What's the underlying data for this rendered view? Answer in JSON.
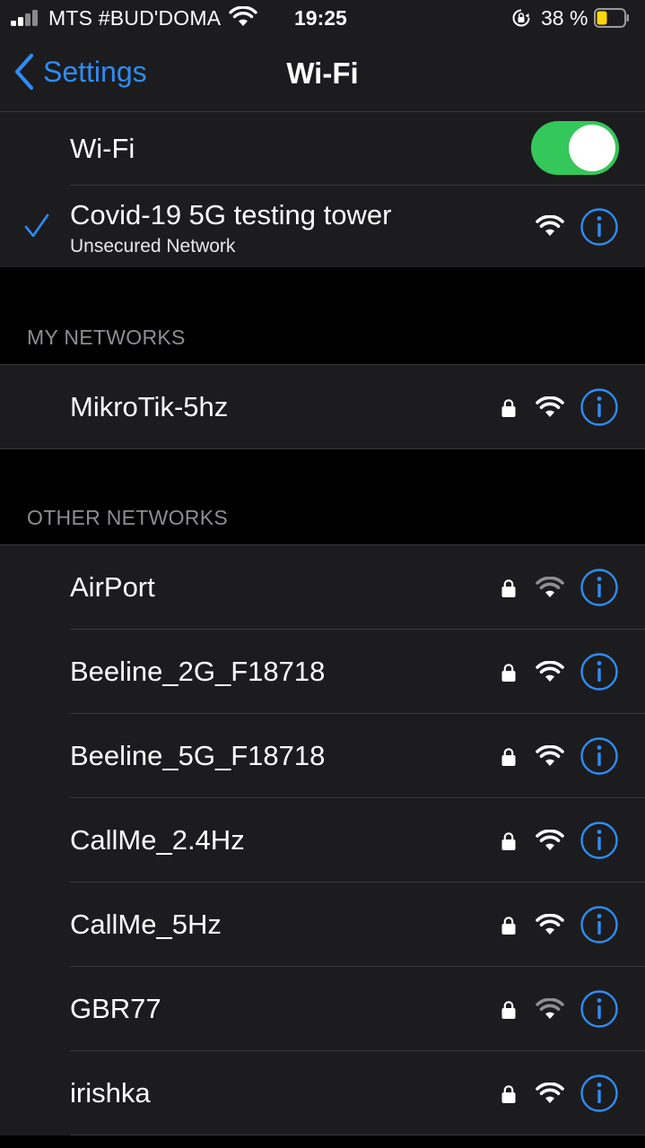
{
  "status_bar": {
    "carrier": "MTS #BUD'DOMA",
    "time": "19:25",
    "battery_percent": "38 %",
    "battery_level": 0.38,
    "battery_color": "#ffd60a"
  },
  "nav": {
    "back_label": "Settings",
    "title": "Wi-Fi"
  },
  "wifi_toggle": {
    "label": "Wi-Fi",
    "on": true,
    "color": "#34c759"
  },
  "connected": {
    "name": "Covid-19 5G testing tower",
    "subtitle": "Unsecured Network",
    "icons": [
      "checkmark-icon",
      "wifi-icon",
      "info-icon"
    ]
  },
  "my_networks": {
    "header": "MY NETWORKS",
    "items": [
      {
        "name": "MikroTik-5hz",
        "secured": true,
        "signal": "full"
      }
    ]
  },
  "other_networks": {
    "header": "OTHER NETWORKS",
    "items": [
      {
        "name": "AirPort",
        "secured": true,
        "signal": "weak"
      },
      {
        "name": "Beeline_2G_F18718",
        "secured": true,
        "signal": "full"
      },
      {
        "name": "Beeline_5G_F18718",
        "secured": true,
        "signal": "full"
      },
      {
        "name": "CallMe_2.4Hz",
        "secured": true,
        "signal": "full"
      },
      {
        "name": "CallMe_5Hz",
        "secured": true,
        "signal": "full"
      },
      {
        "name": "GBR77",
        "secured": true,
        "signal": "weak"
      },
      {
        "name": "irishka",
        "secured": true,
        "signal": "full"
      }
    ]
  },
  "colors": {
    "accent": "#2f8cf4",
    "background": "#000000",
    "cell": "#1c1c1e",
    "separator": "#38383a",
    "section_header": "#8d8d93"
  }
}
